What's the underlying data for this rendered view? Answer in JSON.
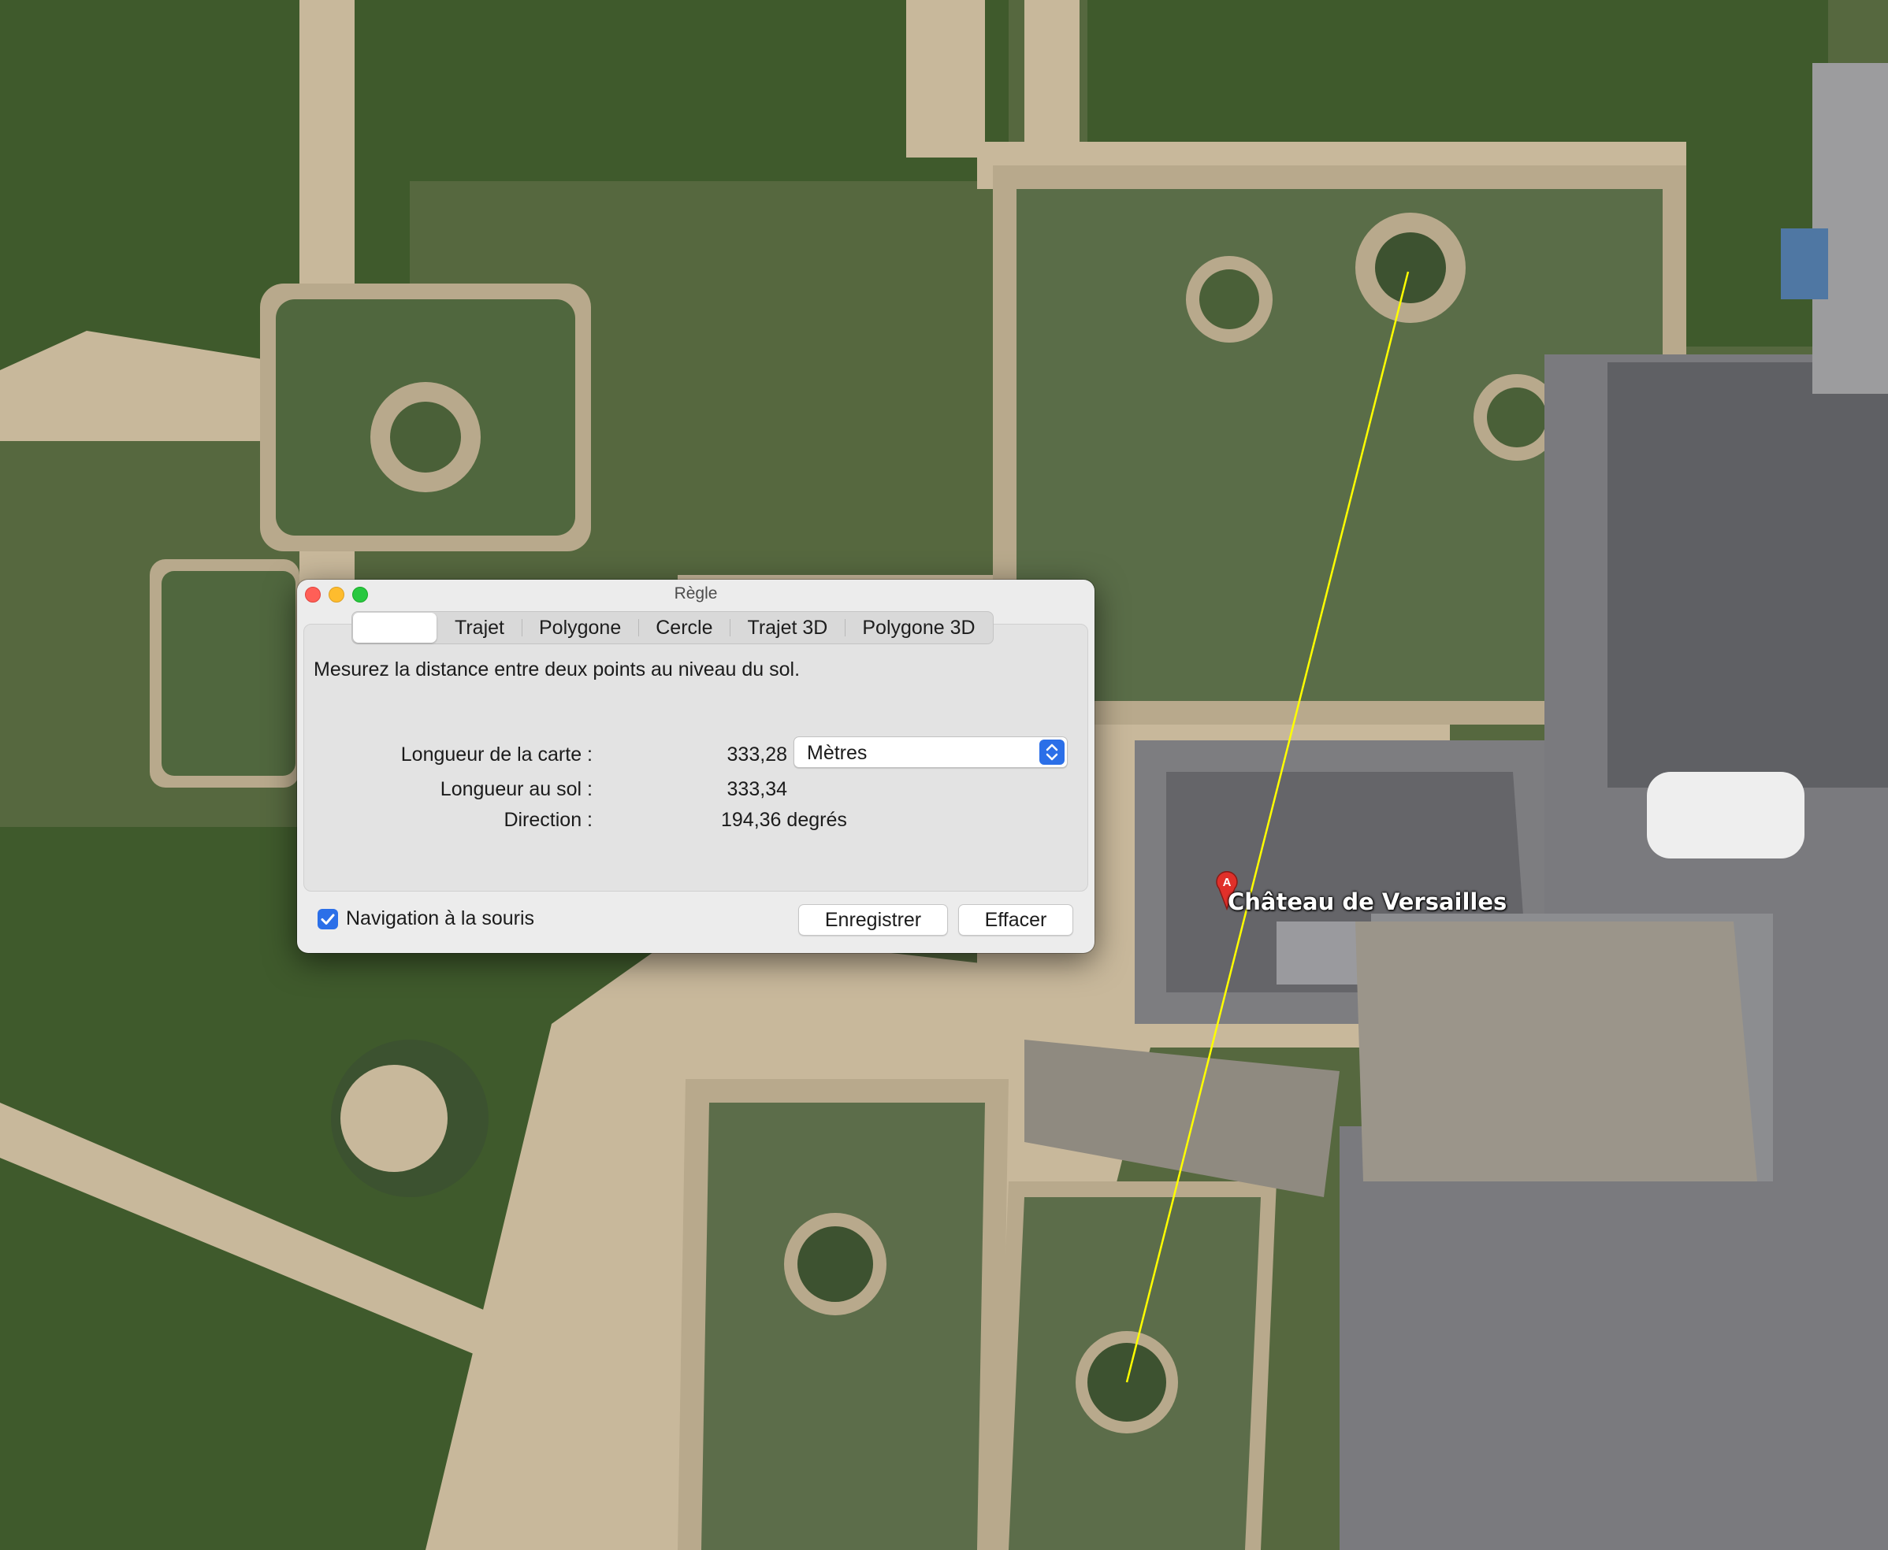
{
  "window": {
    "title": "Règle"
  },
  "tabs": [
    {
      "label": ""
    },
    {
      "label": "Trajet"
    },
    {
      "label": "Polygone"
    },
    {
      "label": "Cercle"
    },
    {
      "label": "Trajet 3D"
    },
    {
      "label": "Polygone 3D"
    }
  ],
  "description": "Mesurez la distance entre deux points au niveau du sol.",
  "measurements": {
    "map_length_label": "Longueur de la carte :",
    "map_length_value": "333,28",
    "ground_length_label": "Longueur au sol :",
    "ground_length_value": "333,34",
    "direction_label": "Direction :",
    "direction_value": "194,36 degrés"
  },
  "units_select": {
    "selected": "Mètres"
  },
  "mouse_navigation": {
    "label": "Navigation à la souris",
    "checked": true
  },
  "buttons": {
    "save": "Enregistrer",
    "clear": "Effacer"
  },
  "map": {
    "placemark_label": "Château de Versailles",
    "placemark_letter": "A"
  },
  "colors": {
    "ruler_line": "#ffff00",
    "accent": "#2b6fe8",
    "pin": "#e0302a"
  }
}
